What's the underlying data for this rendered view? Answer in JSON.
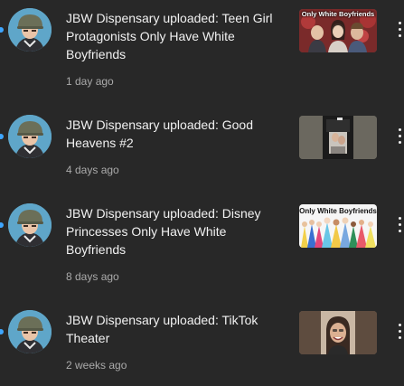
{
  "notifications": [
    {
      "title": "JBW Dispensary uploaded: Teen Girl Protagonists Only Have White Boyfriends",
      "time": "1 day ago",
      "thumbnail_caption": "Only White Boyfriends",
      "unread": true
    },
    {
      "title": "JBW Dispensary uploaded: Good Heavens #2",
      "time": "4 days ago",
      "thumbnail_caption": "",
      "unread": true
    },
    {
      "title": "JBW Dispensary uploaded: Disney Princesses Only Have White Boyfriends",
      "time": "8 days ago",
      "thumbnail_caption": "Only White Boyfriends",
      "unread": true
    },
    {
      "title": "JBW Dispensary uploaded: TikTok Theater",
      "time": "2 weeks ago",
      "thumbnail_caption": "",
      "unread": true
    }
  ],
  "icons": {
    "unread": "unread-dot-icon",
    "more": "more-vert-icon"
  },
  "colors": {
    "background": "#282828",
    "title": "#f1f1f1",
    "secondary": "#aaaaaa",
    "unread_dot": "#3ea6ff"
  }
}
